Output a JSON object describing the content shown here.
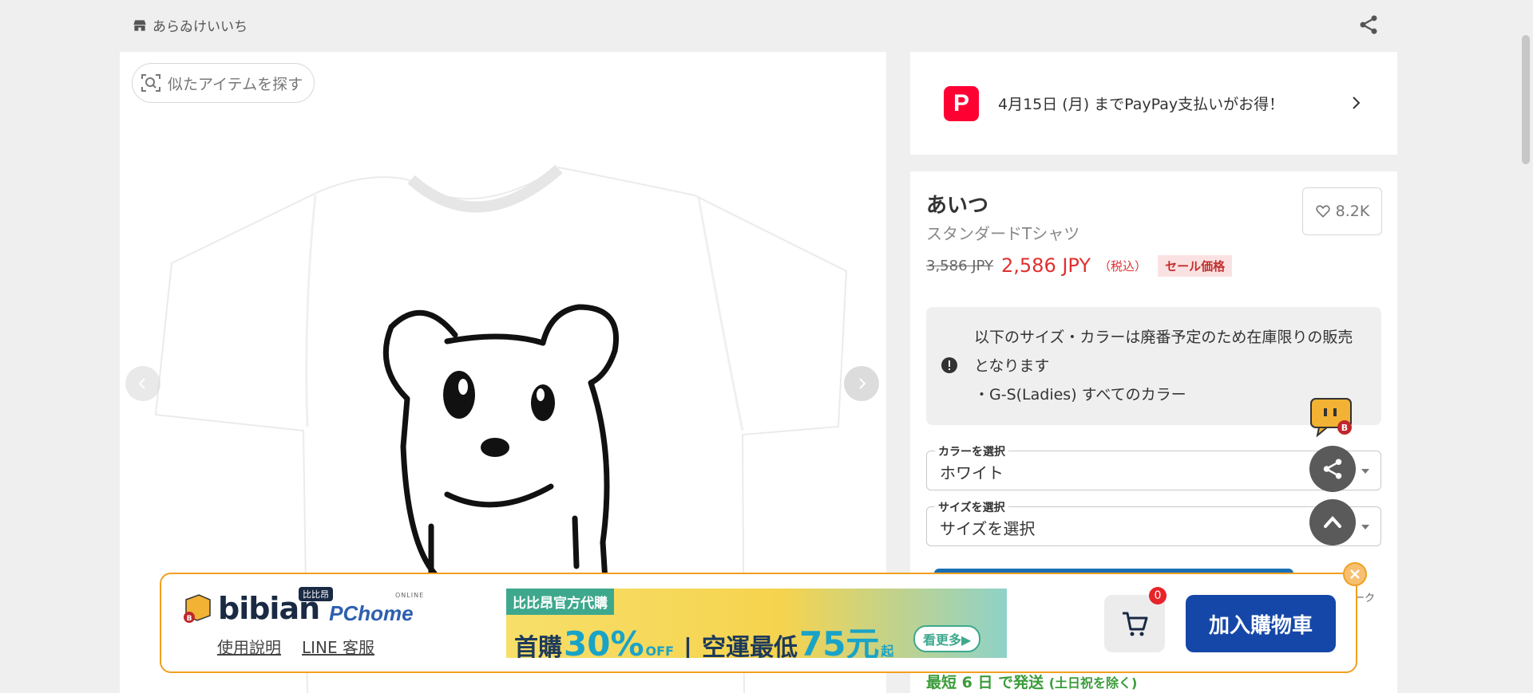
{
  "header": {
    "shop_name": "あらゐけいいち"
  },
  "gallery": {
    "similar_label": "似たアイテムを探す"
  },
  "promo": {
    "text": "4月15日 (月) までPayPay支払いがお得！",
    "logo_letter": "P"
  },
  "product": {
    "title": "あいつ",
    "subtitle": "スタンダードTシャツ",
    "favorites": "8.2K",
    "price_old": "3,586 JPY",
    "price_new": "2,586 JPY",
    "tax_note": "（税込）",
    "sale_badge": "セール価格"
  },
  "notice": {
    "line1": "以下のサイズ・カラーは廃番予定のため在庫限りの販売となります",
    "line2": "・G-S(Ladies) すべてのカラー"
  },
  "selectors": {
    "color_label": "カラーを選択",
    "color_value": "ホワイト",
    "size_label": "サイズを選択",
    "size_value": "サイズを選択"
  },
  "shipping": {
    "text": "最短 6 日 で発送",
    "note": "(土日祝を除く)"
  },
  "partial_label": "ーク",
  "bibian": {
    "logo_word": "bibian",
    "logo_cn": "比比昂",
    "pchome": "PChome",
    "pchome_sub": "ONLINE",
    "link_help": "使用說明",
    "link_line": "LINE 客服",
    "banner_tag": "比比昂官方代購",
    "banner_first": "首購",
    "banner_pct": "30%",
    "banner_off": "OFF",
    "banner_ship": "空運最低",
    "banner_price": "75元",
    "banner_qi": "起",
    "banner_more": "看更多▶",
    "cart_count": "0",
    "add_to_cart": "加入購物車"
  },
  "colors": {
    "price_red": "#e03030",
    "paypay_red": "#ff0033",
    "ship_green": "#3a9c3a",
    "bibian_blue": "#1547a8",
    "bibian_border": "#f0a020"
  }
}
